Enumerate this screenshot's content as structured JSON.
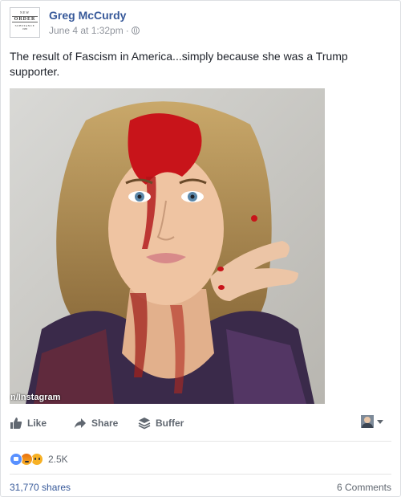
{
  "post": {
    "author": "Greg McCurdy",
    "timestamp": "June 4 at 1:32pm",
    "separator": "·",
    "privacy_icon": "globe-icon",
    "avatar": {
      "line1": "NEW",
      "line2": "ORDER",
      "line3": "SUBSTANCE",
      "line4": "1983"
    },
    "text": "The result of Fascism in America...simply because she was a Trump supporter.",
    "photo_credit": "n/Instagram"
  },
  "actions": {
    "like_label": "Like",
    "share_label": "Share",
    "buffer_label": "Buffer"
  },
  "stats": {
    "reaction_icons": [
      "like-icon",
      "angry-icon",
      "sad-icon"
    ],
    "reaction_count": "2.5K",
    "shares": "31,770 shares",
    "comments": "6 Comments"
  },
  "colors": {
    "link": "#365899",
    "muted": "#90949c",
    "action": "#606770",
    "text": "#1d2129"
  }
}
